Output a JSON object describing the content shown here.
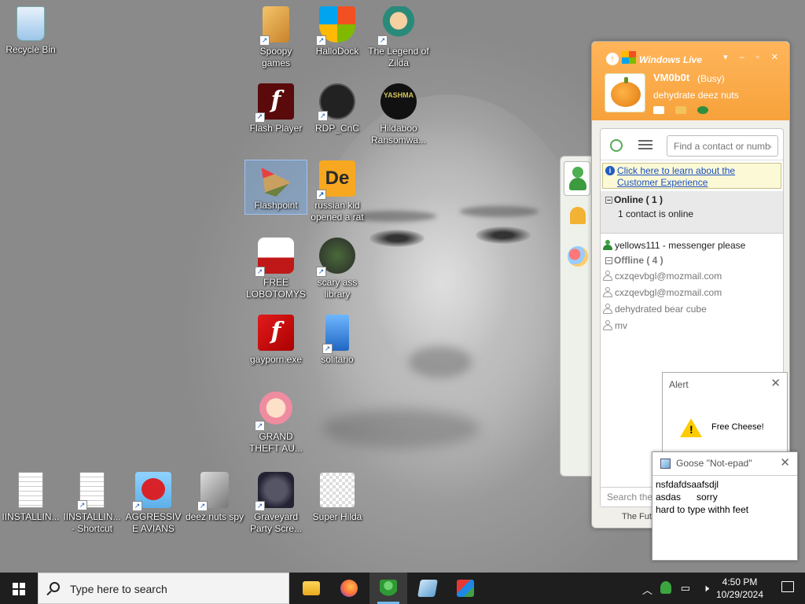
{
  "desktop": {
    "icons": {
      "recycle_bin": "Recycle Bin",
      "spoopy_games": "Spoopy games",
      "hallodock": "HalloDock",
      "legend_zilda": "The Legend of Zilda",
      "flash_player": "Flash Player",
      "rdp_cnc": "RDP_CnC",
      "hildaboo": "Hildaboo Ransomwa...",
      "flashpoint": "Flashpoint",
      "russian_kid": "russian kid opened a rat",
      "free_lobotomys": "FREE LOBOTOMYS",
      "scary_library": "scary ass library",
      "gayporn": "gayporn.exe",
      "solitario": "solitario",
      "gta": "GRAND THEFT AU...",
      "installin1": "IINSTALLIN...",
      "installin2": "IINSTALLIN... - Shortcut",
      "aggressive_avians": "AGGRESSIVE AVIANS",
      "deez_nuts_spy": "deez nuts spy",
      "graveyard": "Graveyard Party Scre...",
      "super_hilda": "Super Hilda"
    },
    "hildaboo_badge": "YASHMA"
  },
  "messenger": {
    "brand": "Windows Live",
    "display_name": "VM0b0t",
    "status": "(Busy)",
    "personal_message": "dehydrate deez nuts",
    "search_placeholder": "Find a contact or number",
    "banner_text": "Click here to learn about the Customer Experience",
    "online_header": "Online ( 1 )",
    "online_sub": "1 contact is online",
    "offline_header": "Offline ( 4 )",
    "online_contacts": [
      "yellows111 - messenger please"
    ],
    "offline_contacts": [
      "cxzqevbgl@mozmail.com",
      "cxzqevbgl@mozmail.com",
      "dehydrated bear cube",
      "mv"
    ],
    "bottom_search": "Search the",
    "footer": "The Fut"
  },
  "alert": {
    "title": "Alert",
    "message": "Free Cheese!"
  },
  "goose_notepad": {
    "title": "Goose \"Not-epad\"",
    "lines": [
      "nsfdafdsaafsdjl",
      "asdas      sorry",
      "hard to type withh feet"
    ]
  },
  "taskbar": {
    "search_placeholder": "Type here to search",
    "time": "4:50 PM",
    "date": "10/29/2024"
  }
}
